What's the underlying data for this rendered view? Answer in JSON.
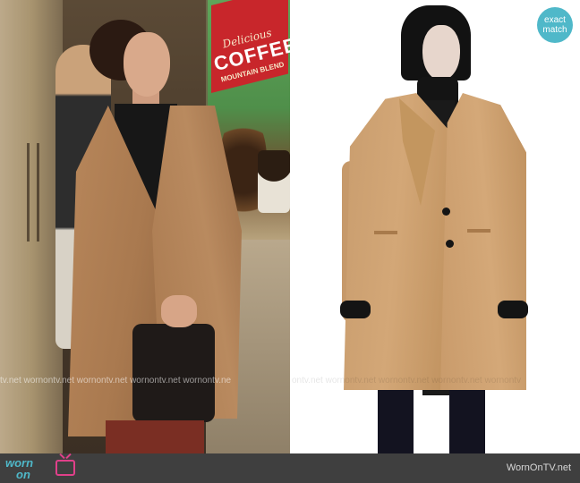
{
  "poster": {
    "line1": "Delicious",
    "line2": "COFFEE",
    "line3": "MOUNTAIN BLEND"
  },
  "watermark": {
    "left_row": "tv.net wornontv.net wornontv.net wornontv.net wornontv.ne",
    "right_row": "ontv.net wornontv.net wornontv.net wornontv.net wornontv"
  },
  "badge": {
    "line1": "exact",
    "line2": "match",
    "color": "#4fb8c9"
  },
  "footer": {
    "logo_line1": "worn",
    "logo_line2": "on",
    "logo_icon": "tv-icon",
    "site_name": "WornOnTV.net",
    "bg": "#3f3f3f",
    "logo_color": "#4fb8c9",
    "icon_color": "#e0408a"
  }
}
